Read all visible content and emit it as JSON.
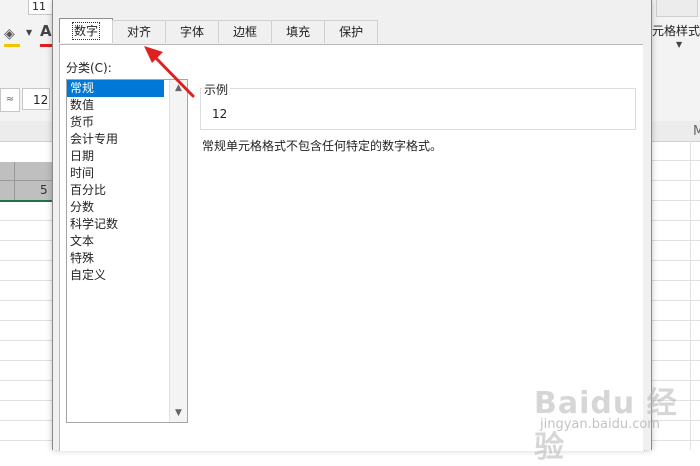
{
  "excel": {
    "font_size_partial": "11",
    "left_cell_a": "≈",
    "left_cell_b": "12",
    "styles_label": "元格样式",
    "col_letter": "M",
    "cell_value": "5",
    "fill_color": "#f2c400",
    "font_color": "#e02020",
    "accent": "#217346"
  },
  "dialog": {
    "tabs": [
      {
        "label": "数字",
        "active": true
      },
      {
        "label": "对齐",
        "active": false
      },
      {
        "label": "字体",
        "active": false
      },
      {
        "label": "边框",
        "active": false
      },
      {
        "label": "填充",
        "active": false
      },
      {
        "label": "保护",
        "active": false
      }
    ],
    "category_label": "分类(C):",
    "categories": [
      "常规",
      "数值",
      "货币",
      "会计专用",
      "日期",
      "时间",
      "百分比",
      "分数",
      "科学记数",
      "文本",
      "特殊",
      "自定义"
    ],
    "selected_category": "常规",
    "sample": {
      "title": "示例",
      "value": "12"
    },
    "description": "常规单元格格式不包含任何特定的数字格式。"
  },
  "watermark": {
    "main": "Baidu 经验",
    "sub": "jingyan.baidu.com"
  },
  "annotation_color": "#e02020"
}
